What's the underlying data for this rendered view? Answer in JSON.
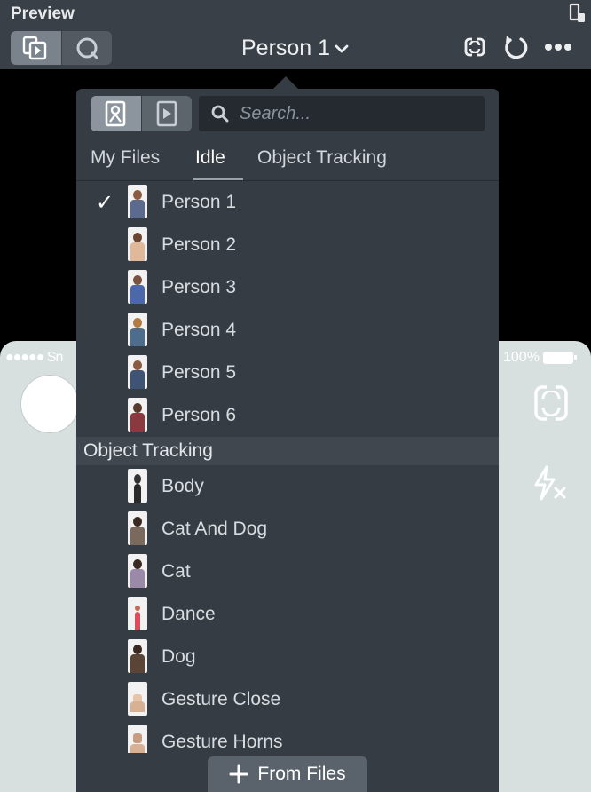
{
  "header": {
    "title": "Preview",
    "selected_person": "Person 1",
    "icons": [
      "device-orientation-icon",
      "media-preview-icon",
      "snap-camera-icon",
      "chevron-down-icon",
      "swap-camera-icon",
      "refresh-icon",
      "more-icon"
    ]
  },
  "phone": {
    "status_left": "●●●●● Sn",
    "battery_text": "100%"
  },
  "popover": {
    "search_placeholder": "Search...",
    "tabs": [
      {
        "label": "My Files"
      },
      {
        "label": "Idle"
      },
      {
        "label": "Object Tracking"
      }
    ],
    "active_tab": "Idle",
    "idle_items": [
      {
        "label": "Person 1",
        "selected": true,
        "check": "✓"
      },
      {
        "label": "Person 2",
        "selected": false
      },
      {
        "label": "Person 3",
        "selected": false
      },
      {
        "label": "Person 4",
        "selected": false
      },
      {
        "label": "Person 5",
        "selected": false
      },
      {
        "label": "Person 6",
        "selected": false
      }
    ],
    "section_header": "Object Tracking",
    "tracking_items": [
      {
        "label": "Body"
      },
      {
        "label": "Cat And Dog"
      },
      {
        "label": "Cat"
      },
      {
        "label": "Dance"
      },
      {
        "label": "Dog"
      },
      {
        "label": "Gesture Close"
      },
      {
        "label": "Gesture Horns"
      }
    ],
    "from_files_label": "From Files"
  },
  "colors": {
    "toolbar": "#3a4047",
    "popover": "#353c43",
    "search_bg": "#242a30",
    "section_bg": "#40474e",
    "phone_bg": "#d7dfdf"
  }
}
